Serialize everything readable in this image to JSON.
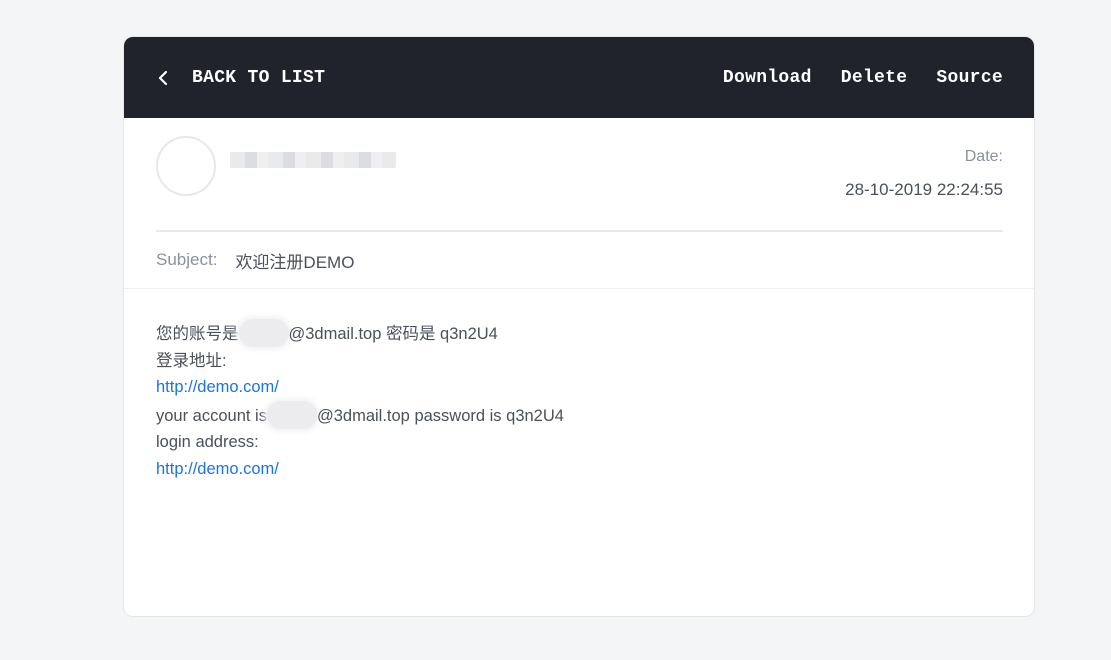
{
  "header": {
    "back_label": "BACK TO LIST",
    "actions": [
      "Download",
      "Delete",
      "Source"
    ]
  },
  "message": {
    "date_label": "Date:",
    "date_value": "28-10-2019 22:24:55",
    "subject_label": "Subject:",
    "subject_value": "欢迎注册DEMO",
    "body": {
      "line1_prefix": "您的账号是",
      "line1_suffix": "@3dmail.top 密码是 q3n2U4",
      "line2": "登录地址:",
      "link1": "http://demo.com/",
      "line4_prefix": "your account is",
      "line4_suffix": "@3dmail.top password is q3n2U4",
      "line5": "login address:",
      "link2": "http://demo.com/"
    }
  },
  "colors": {
    "header_bg": "#20232b",
    "link": "#1a73e8",
    "page_bg": "#f4f5f7"
  },
  "icons": {
    "back": "chevron-left-icon"
  }
}
